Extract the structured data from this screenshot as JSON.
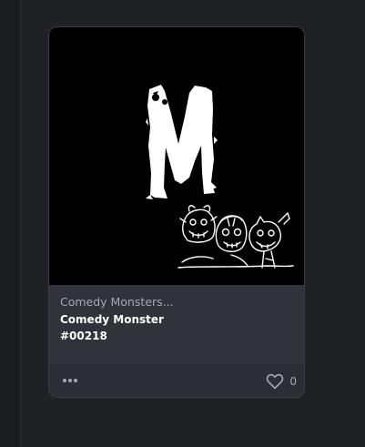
{
  "card": {
    "collection_name": "Comedy Monsters...",
    "item_name": "Comedy Monster",
    "item_number": "#00218",
    "like_count": "0"
  },
  "icons": {
    "more": "more-horizontal-icon",
    "like": "heart-outline-icon"
  },
  "colors": {
    "page_bg": "#202124",
    "card_bg": "#2f3238",
    "media_bg": "#000000",
    "muted_text": "#a6a9b0",
    "title_text": "#ffffff"
  }
}
